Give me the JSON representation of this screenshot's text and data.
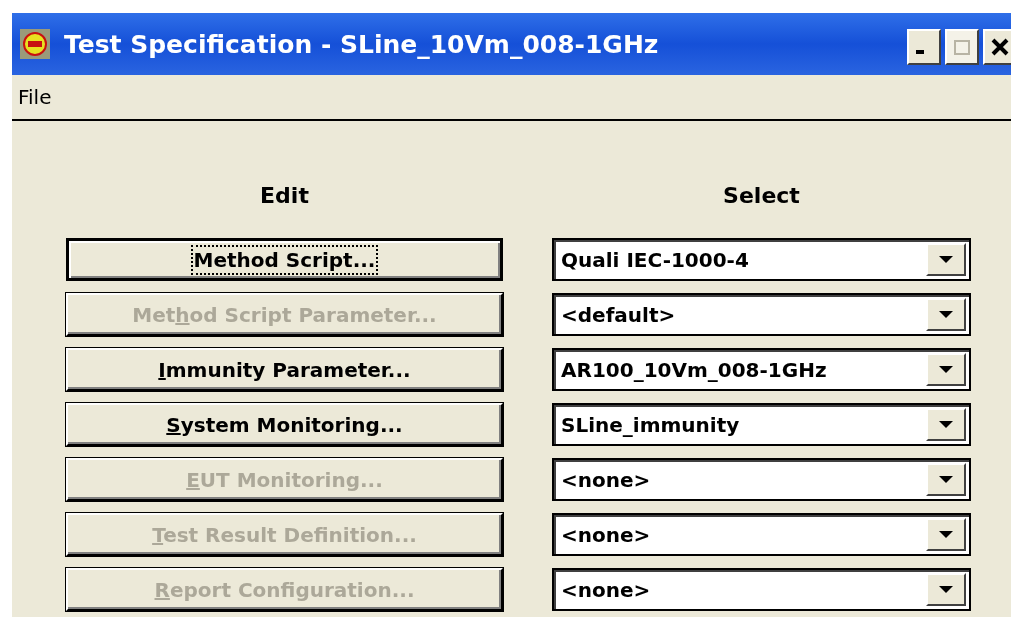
{
  "window": {
    "title": "Test Specification - SLine_10Vm_008-1GHz",
    "controls": [
      {
        "kind": "minimize",
        "disabled": false
      },
      {
        "kind": "maximize",
        "disabled": true
      },
      {
        "kind": "close",
        "disabled": false
      }
    ]
  },
  "menu": [
    "File"
  ],
  "columns": {
    "edit": "Edit",
    "select": "Select"
  },
  "rows": [
    {
      "button": {
        "after": "Method Script...",
        "disabled": false,
        "focused": true
      },
      "select": "Quali IEC-1000-4"
    },
    {
      "button": {
        "before": "Met",
        "key": "h",
        "after": "od Script Parameter...",
        "disabled": true,
        "focused": false
      },
      "select": "<default>"
    },
    {
      "button": {
        "key": "I",
        "after": "mmunity Parameter...",
        "disabled": false,
        "focused": false
      },
      "select": "AR100_10Vm_008-1GHz"
    },
    {
      "button": {
        "key": "S",
        "after": "ystem Monitoring...",
        "disabled": false,
        "focused": false
      },
      "select": "SLine_immunity"
    },
    {
      "button": {
        "key": "E",
        "after": "UT Monitoring...",
        "disabled": true,
        "focused": false
      },
      "select": "<none>"
    },
    {
      "button": {
        "key": "T",
        "after": "est Result Definition...",
        "disabled": true,
        "focused": false
      },
      "select": "<none>"
    },
    {
      "button": {
        "key": "R",
        "after": "eport Configuration...",
        "disabled": true,
        "focused": false
      },
      "select": "<none>"
    }
  ]
}
